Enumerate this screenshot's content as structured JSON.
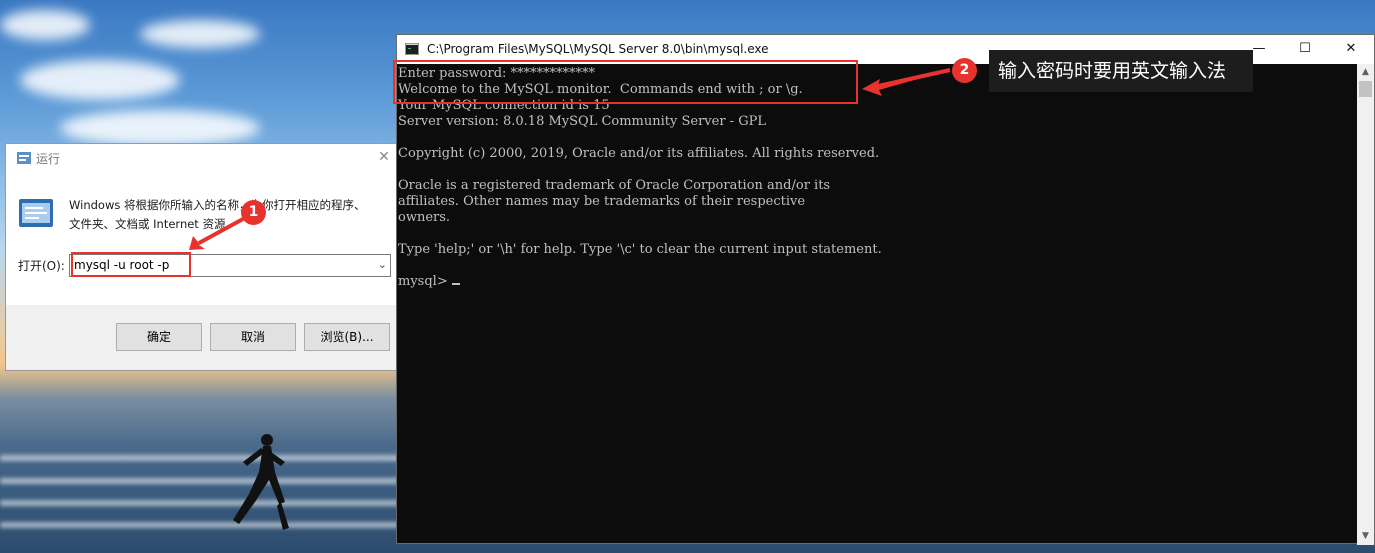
{
  "run_dialog": {
    "title": "运行",
    "description_line1": "Windows 将根据你所输入的名称，为你打开相应的程序、",
    "description_line2": "文件夹、文档或 Internet 资源。",
    "open_label": "打开(O):",
    "command_value": "mysql -u root -p",
    "ok_label": "确定",
    "cancel_label": "取消",
    "browse_label": "浏览(B)..."
  },
  "console": {
    "title": "C:\\Program Files\\MySQL\\MySQL Server 8.0\\bin\\mysql.exe",
    "minimize_glyph": "—",
    "maximize_glyph": "☐",
    "close_glyph": "✕",
    "lines": [
      "Enter password: *************",
      "Welcome to the MySQL monitor.  Commands end with ; or \\g.",
      "Your MySQL connection id is 15",
      "Server version: 8.0.18 MySQL Community Server - GPL",
      "",
      "Copyright (c) 2000, 2019, Oracle and/or its affiliates. All rights reserved.",
      "",
      "Oracle is a registered trademark of Oracle Corporation and/or its",
      "affiliates. Other names may be trademarks of their respective",
      "owners.",
      "",
      "Type 'help;' or '\\h' for help. Type '\\c' to clear the current input statement.",
      "",
      "mysql> "
    ]
  },
  "annotations": {
    "badge1": "1",
    "badge2": "2",
    "tip": "输入密码时要用英文输入法",
    "accent_color": "#e8322e"
  },
  "icons": {
    "run_title_icon": "run-icon",
    "run_big_icon": "run-program-icon",
    "console_icon": "console-icon",
    "dropdown": "chevron-down-icon"
  }
}
